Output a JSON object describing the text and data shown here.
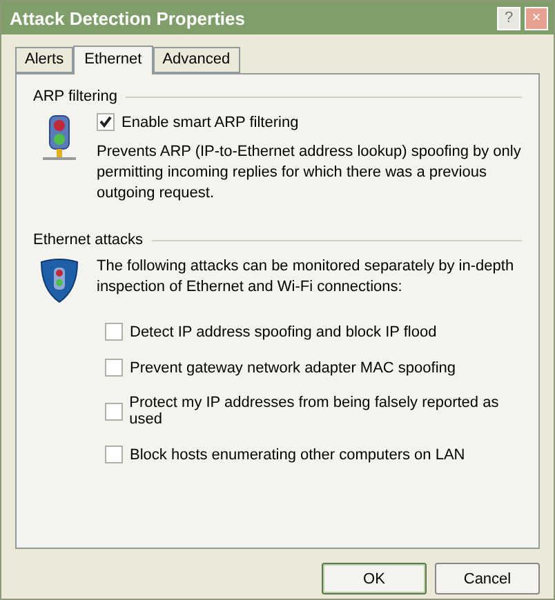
{
  "window": {
    "title": "Attack Detection Properties",
    "help_button": "?",
    "close_button": "×"
  },
  "tabs": [
    {
      "label": "Alerts",
      "selected": false
    },
    {
      "label": "Ethernet",
      "selected": true
    },
    {
      "label": "Advanced",
      "selected": false
    }
  ],
  "arp_filtering": {
    "heading": "ARP filtering",
    "checkbox": {
      "label": "Enable smart ARP filtering",
      "checked": true
    },
    "description": "Prevents ARP (IP-to-Ethernet address lookup) spoofing by only permitting incoming replies for which there was a previous outgoing request."
  },
  "ethernet_attacks": {
    "heading": "Ethernet attacks",
    "description": "The following attacks can be monitored separately by in-depth inspection of Ethernet and Wi-Fi connections:",
    "options": [
      {
        "label": "Detect IP address spoofing and block IP flood",
        "checked": false
      },
      {
        "label": "Prevent gateway network adapter MAC spoofing",
        "checked": false
      },
      {
        "label": "Protect my IP addresses from being falsely reported as used",
        "checked": false
      },
      {
        "label": "Block hosts enumerating other computers on LAN",
        "checked": false
      }
    ]
  },
  "buttons": [
    {
      "label": "OK",
      "default": true
    },
    {
      "label": "Cancel",
      "default": false
    }
  ]
}
